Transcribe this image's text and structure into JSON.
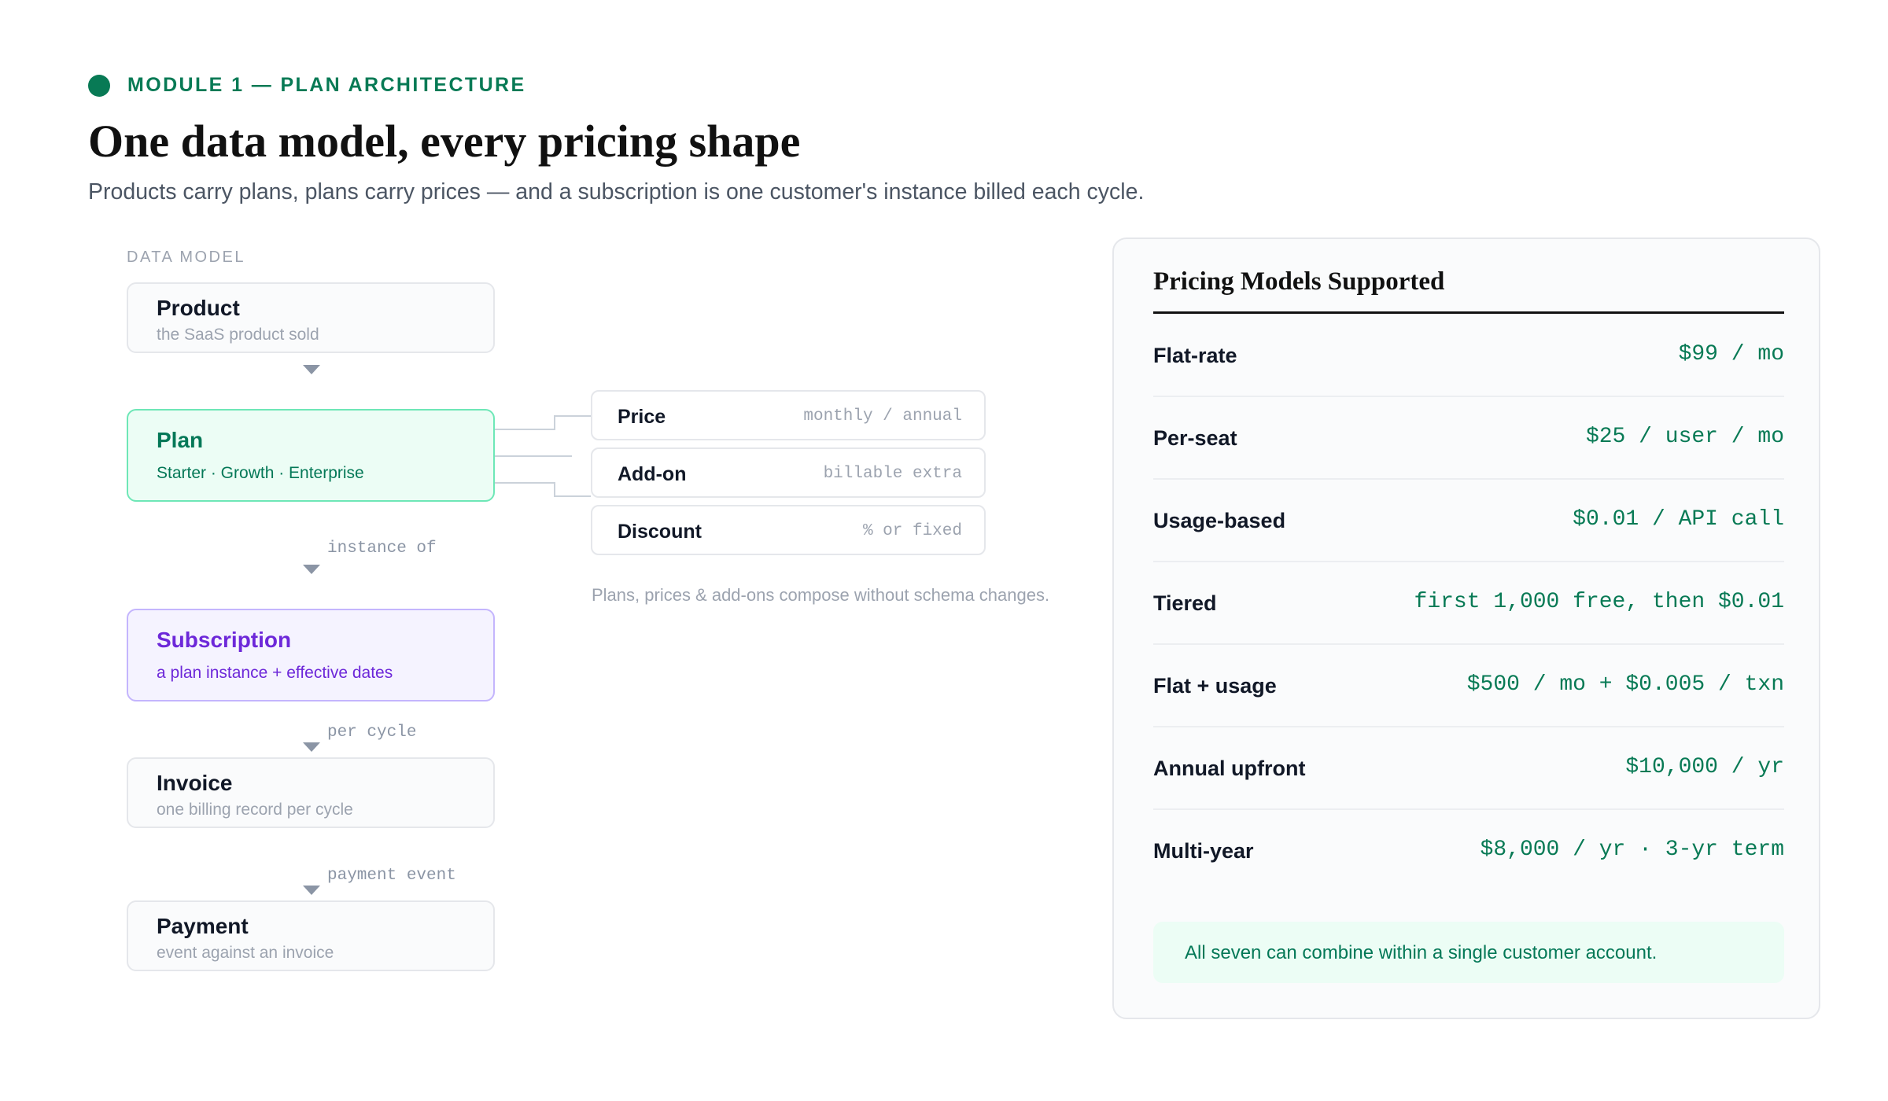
{
  "header": {
    "eyebrow": "MODULE 1 — PLAN ARCHITECTURE",
    "title": "One data model, every pricing shape",
    "subtitle": "Products carry plans, plans carry prices — and a subscription is one customer's instance billed each cycle."
  },
  "data_model": {
    "label": "DATA MODEL",
    "nodes": [
      {
        "title": "Product",
        "sub": "the SaaS product sold"
      },
      {
        "title": "Plan",
        "sub": "Starter · Growth · Enterprise"
      },
      {
        "title": "Subscription",
        "sub": "a plan instance + effective dates"
      },
      {
        "title": "Invoice",
        "sub": "one billing record per cycle"
      },
      {
        "title": "Payment",
        "sub": "event against an invoice"
      }
    ],
    "edges": [
      "instance of",
      "per cycle",
      "payment event"
    ],
    "components": [
      {
        "name": "Price",
        "value": "monthly / annual"
      },
      {
        "name": "Add-on",
        "value": "billable extra"
      },
      {
        "name": "Discount",
        "value": "% or fixed"
      }
    ],
    "components_note": "Plans, prices & add-ons compose without schema changes."
  },
  "pricing": {
    "title": "Pricing Models Supported",
    "rows": [
      {
        "name": "Flat-rate",
        "value": "$99 / mo"
      },
      {
        "name": "Per-seat",
        "value": "$25 / user / mo"
      },
      {
        "name": "Usage-based",
        "value": "$0.01 / API call"
      },
      {
        "name": "Tiered",
        "value": "first 1,000 free, then $0.01"
      },
      {
        "name": "Flat + usage",
        "value": "$500 / mo + $0.005 / txn"
      },
      {
        "name": "Annual upfront",
        "value": "$10,000 / yr"
      },
      {
        "name": "Multi-year",
        "value": "$8,000 / yr · 3-yr term"
      }
    ],
    "note": "All seven can combine within a single customer account."
  },
  "colors": {
    "accent": "#087a55",
    "plan_border": "#6ee7b7",
    "plan_fill": "#ecfdf5",
    "subscription_border": "#c4b5fd",
    "subscription_text": "#6d28d9",
    "connector": "#cbd2da"
  }
}
